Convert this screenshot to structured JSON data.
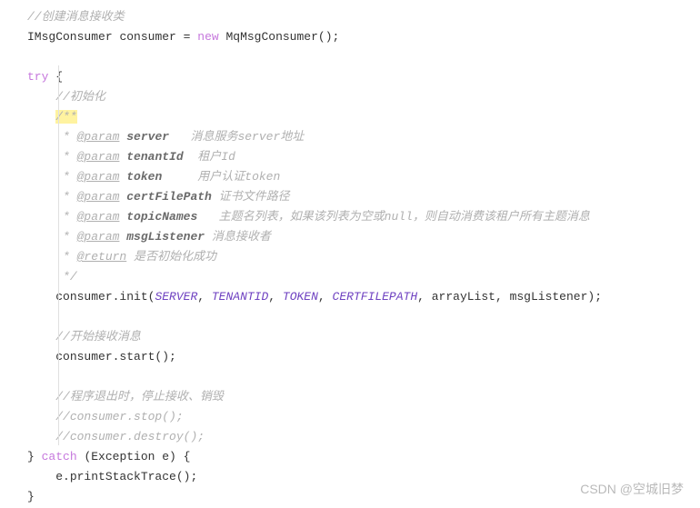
{
  "c1": "//创建消息接收类",
  "decl_type": "IMsgConsumer",
  "decl_var": "consumer",
  "eq": " = ",
  "kw_new": "new",
  "ctor": " MqMsgConsumer();",
  "kw_try": "try",
  "brace_open": " {",
  "c2": "//初始化",
  "doc_open": "/**",
  "star": " * ",
  "param_tag": "@param",
  "return_tag": "@return",
  "p1_name": " server",
  "p1_desc": "消息服务server地址",
  "p2_name": " tenantId",
  "p2_desc": "租户Id",
  "p3_name": " token",
  "p3_desc": "用户认证token",
  "p4_name": " certFilePath",
  "p4_desc": "证书文件路径",
  "p5_name": " topicNames",
  "p5_desc": "主题名列表，如果该列表为空或null，则自动消费该租户所有主题消息",
  "p6_name": " msgListener",
  "p6_desc": "消息接收者",
  "ret_desc": " 是否初始化成功",
  "doc_close": " */",
  "init_call1": "consumer.init(",
  "const1": "SERVER",
  "sep": ", ",
  "const2": "TENANTID",
  "const3": "TOKEN",
  "const4": "CERTFILEPATH",
  "arg5": "arrayList",
  "arg6": "msgListener",
  "init_call2": ");",
  "c3": "//开始接收消息",
  "start_call": "consumer.start();",
  "c4": "//程序退出时，停止接收、销毁",
  "c5": "//consumer.stop();",
  "c6": "//consumer.destroy();",
  "brace_close": "}",
  "kw_catch": "catch",
  "catch_args": " (Exception e) {",
  "stack": "e.printStackTrace();",
  "close2": "}",
  "watermark": "CSDN @​空城旧梦"
}
